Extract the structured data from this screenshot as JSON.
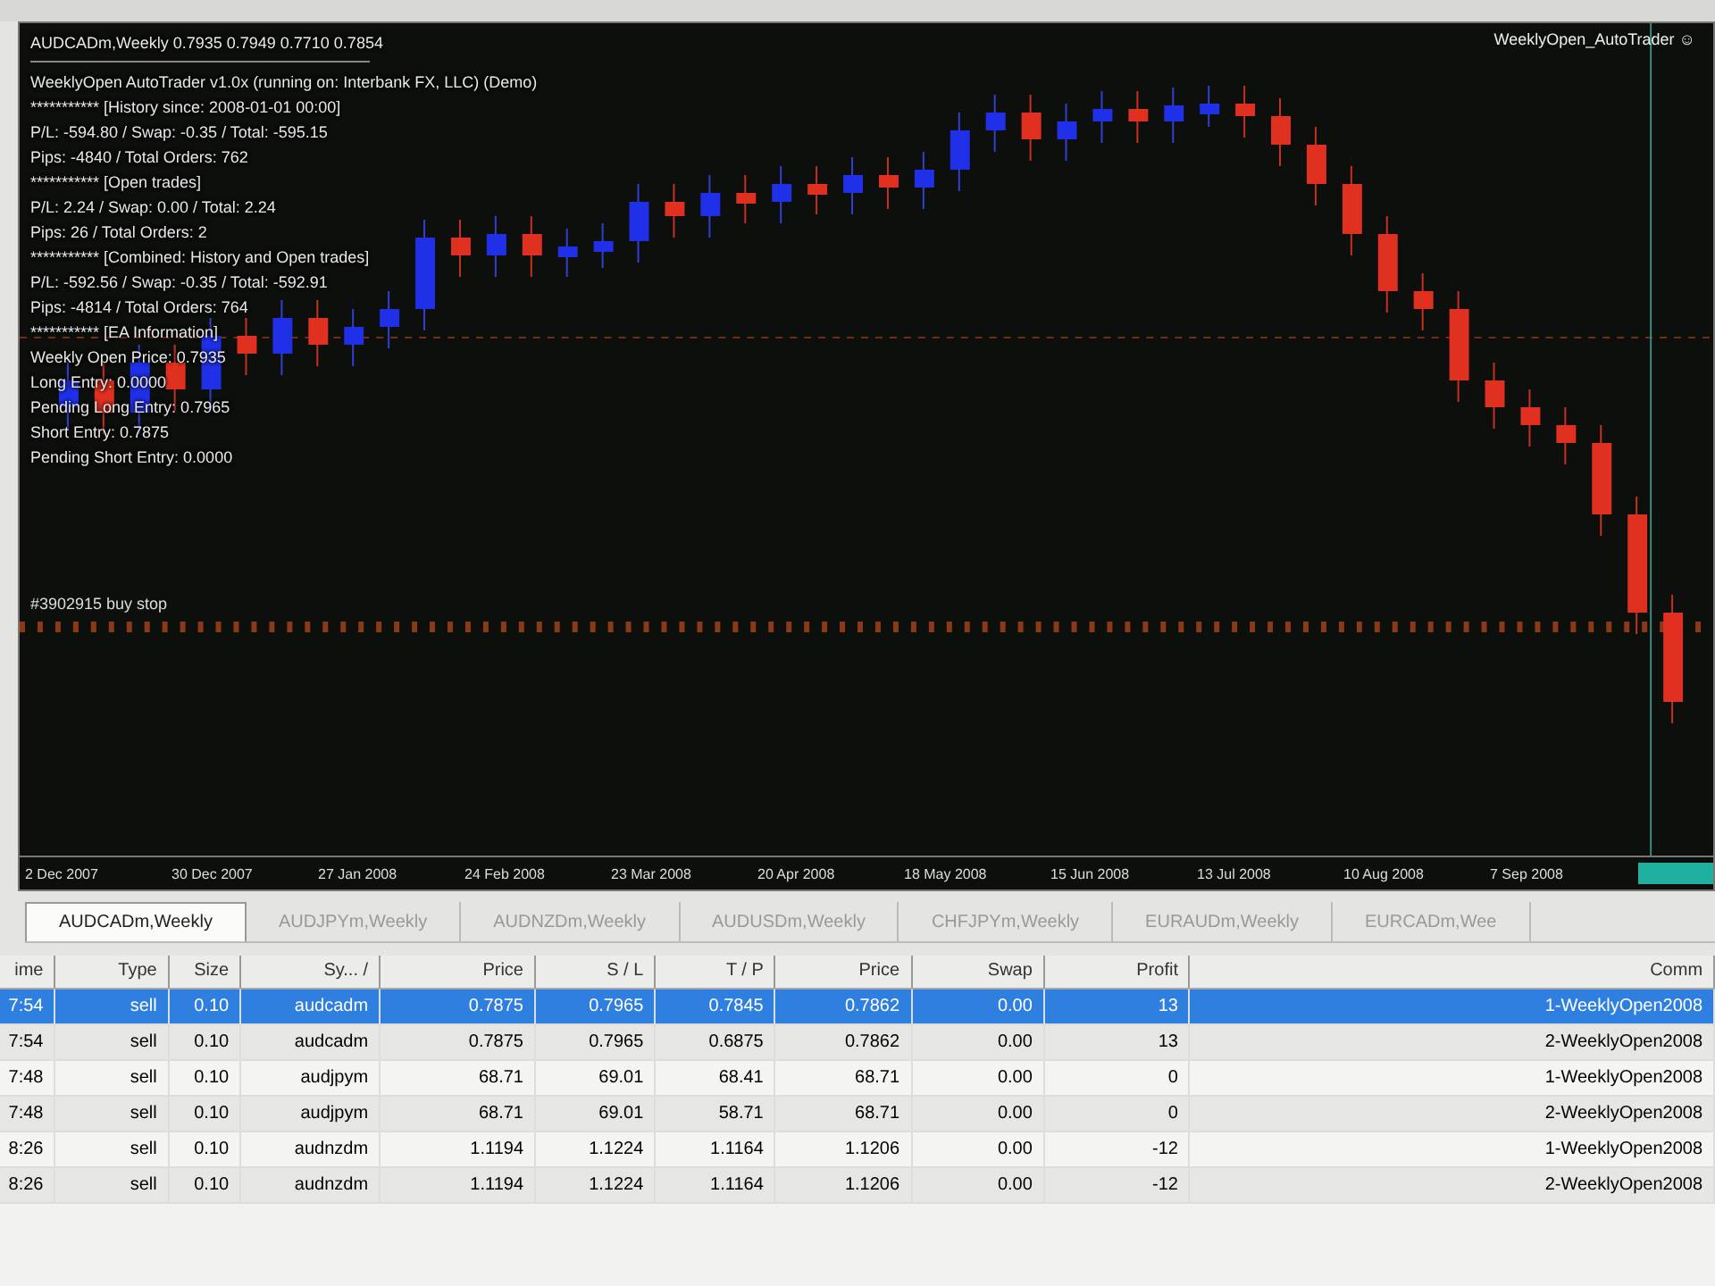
{
  "chart": {
    "title": "AUDCADm,Weekly  0.7935 0.7949 0.7710 0.7854",
    "expert_label": "WeeklyOpen_AutoTrader ☺",
    "info_lines": [
      "WeeklyOpen AutoTrader v1.0x (running on: Interbank FX, LLC) (Demo)",
      "*********** [History since: 2008-01-01 00:00]",
      "P/L: -594.80 / Swap: -0.35 / Total: -595.15",
      "Pips: -4840 / Total Orders: 762",
      "*********** [Open trades]",
      "P/L: 2.24 / Swap: 0.00 / Total: 2.24",
      "Pips: 26 / Total Orders: 2",
      "*********** [Combined: History and Open trades]",
      "P/L: -592.56 / Swap: -0.35 / Total: -592.91",
      "Pips: -4814 / Total Orders: 764",
      "*********** [EA Information]",
      "Weekly Open Price: 0.7935",
      "Long Entry: 0.0000",
      "Pending Long Entry: 0.7965",
      "Short Entry: 0.7875",
      "Pending Short Entry: 0.0000"
    ],
    "order_label": "#3902915 buy stop",
    "dates": [
      "2 Dec 2007",
      "30 Dec 2007",
      "27 Jan 2008",
      "24 Feb 2008",
      "23 Mar 2008",
      "20 Apr 2008",
      "18 May 2008",
      "15 Jun 2008",
      "13 Jul 2008",
      "10 Aug 2008",
      "7 Sep 2008"
    ]
  },
  "tabs": [
    {
      "label": "AUDCADm,Weekly",
      "selected": true
    },
    {
      "label": "AUDJPYm,Weekly",
      "selected": false
    },
    {
      "label": "AUDNZDm,Weekly",
      "selected": false
    },
    {
      "label": "AUDUSDm,Weekly",
      "selected": false
    },
    {
      "label": "CHFJPYm,Weekly",
      "selected": false
    },
    {
      "label": "EURAUDm,Weekly",
      "selected": false
    },
    {
      "label": "EURCADm,Wee",
      "selected": false
    }
  ],
  "table": {
    "columns": [
      "ime",
      "Type",
      "Size",
      "Sy...  /",
      "Price",
      "S / L",
      "T / P",
      "Price",
      "Swap",
      "Profit",
      "Comm"
    ],
    "rows": [
      {
        "selected": true,
        "cells": [
          "7:54",
          "sell",
          "0.10",
          "audcadm",
          "0.7875",
          "0.7965",
          "0.7845",
          "0.7862",
          "0.00",
          "13",
          "1-WeeklyOpen2008"
        ]
      },
      {
        "selected": false,
        "cells": [
          "7:54",
          "sell",
          "0.10",
          "audcadm",
          "0.7875",
          "0.7965",
          "0.6875",
          "0.7862",
          "0.00",
          "13",
          "2-WeeklyOpen2008"
        ]
      },
      {
        "selected": false,
        "cells": [
          "7:48",
          "sell",
          "0.10",
          "audjpym",
          "68.71",
          "69.01",
          "68.41",
          "68.71",
          "0.00",
          "0",
          "1-WeeklyOpen2008"
        ]
      },
      {
        "selected": false,
        "cells": [
          "7:48",
          "sell",
          "0.10",
          "audjpym",
          "68.71",
          "69.01",
          "58.71",
          "68.71",
          "0.00",
          "0",
          "2-WeeklyOpen2008"
        ]
      },
      {
        "selected": false,
        "cells": [
          "8:26",
          "sell",
          "0.10",
          "audnzdm",
          "1.1194",
          "1.1224",
          "1.1164",
          "1.1206",
          "0.00",
          "-12",
          "1-WeeklyOpen2008"
        ]
      },
      {
        "selected": false,
        "cells": [
          "8:26",
          "sell",
          "0.10",
          "audnzdm",
          "1.1194",
          "1.1224",
          "1.1164",
          "1.1206",
          "0.00",
          "-12",
          "2-WeeklyOpen2008"
        ]
      }
    ]
  }
}
